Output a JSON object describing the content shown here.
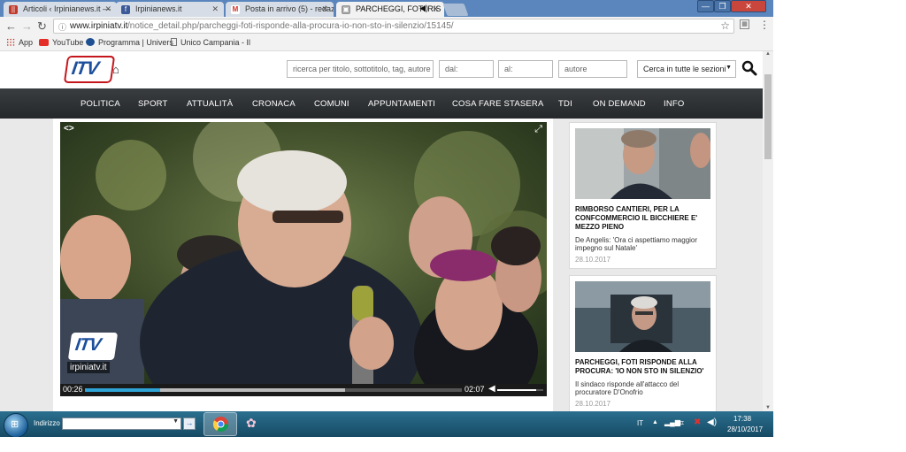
{
  "tabs": [
    {
      "label": "Articoli ‹ Irpinianews.it —",
      "icon": "irpinianews-favicon",
      "color": "#c0392b",
      "glyph": "||"
    },
    {
      "label": "Irpinianews.it",
      "icon": "facebook-favicon",
      "color": "#3b5998",
      "glyph": "f"
    },
    {
      "label": "Posta in arrivo (5) - redaz",
      "icon": "gmail-favicon",
      "color": "#d93025",
      "glyph": "M"
    },
    {
      "label": "PARCHEGGI, FOTI RIS",
      "icon": "itv-favicon",
      "color": "#888888",
      "glyph": "▣",
      "active": true
    }
  ],
  "browser": {
    "url_host": "www.irpiniatv.it",
    "url_path": "/notice_detail.php/parcheggi-foti-risponde-alla-procura-io-non-sto-in-silenzio/15145/"
  },
  "bookmarks": [
    "App",
    "YouTube",
    "Programma | Univers",
    "Unico Campania - Il"
  ],
  "site": {
    "logo": "ITV",
    "search_placeholder": "ricerca per titolo, sottotitolo, tag, autore",
    "from_placeholder": "dal:",
    "to_placeholder": "al:",
    "author_placeholder": "autore",
    "section_select": "Cerca in tutte le sezioni"
  },
  "nav": [
    "POLITICA",
    "SPORT",
    "ATTUALITÀ",
    "CRONACA",
    "COMUNI",
    "APPUNTAMENTI",
    "COSA FARE STASERA",
    "TDI",
    "ON DEMAND",
    "INFO"
  ],
  "video": {
    "watermark_logo": "ITV",
    "watermark_site": "irpiniatv.it",
    "time_current": "00:26",
    "time_total": "02:07",
    "progress_played": 0.2,
    "progress_buffered": 0.69,
    "volume": 0.85
  },
  "sidebar": [
    {
      "title": "RIMBORSO CANTIERI, PER LA CONFCOMMERCIO IL BICCHIERE E' MEZZO PIENO",
      "desc": "De Angelis: 'Ora ci aspettiamo maggior impegno sul Natale'",
      "date": "28.10.2017"
    },
    {
      "title": "PARCHEGGI, FOTI RISPONDE ALLA PROCURA: 'IO NON STO IN SILENZIO'",
      "desc": "Il sindaco risponde all'attacco del procuratore D'Onofrio",
      "date": "28.10.2017"
    }
  ],
  "taskbar": {
    "address_label": "Indirizzo",
    "lang": "IT",
    "time": "17:38",
    "date": "28/10/2017"
  }
}
